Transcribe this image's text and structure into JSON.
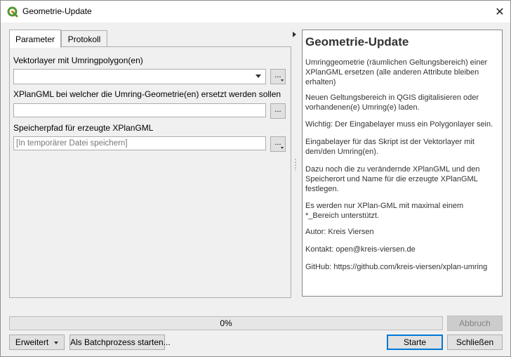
{
  "window": {
    "title": "Geometrie-Update",
    "close_symbol": "✕"
  },
  "tabs": [
    {
      "label": "Parameter",
      "active": true
    },
    {
      "label": "Protokoll",
      "active": false
    }
  ],
  "params": {
    "layer_label": "Vektorlayer mit Umringpolygon(en)",
    "layer_value": "",
    "xplan_label": "XPlanGML bei welcher die Umring-Geometrie(en) ersetzt werden sollen",
    "xplan_value": "",
    "output_label": "Speicherpfad für erzeugte XPlanGML",
    "output_placeholder": "[In temporärer Datei speichern]",
    "browse_label": "..."
  },
  "help": {
    "title": "Geometrie-Update",
    "paragraphs": [
      "Umringgeometrie (räumlichen Geltungsbereich) einer XPlanGML ersetzen (alle anderen Attribute bleiben erhalten)",
      "Neuen Geltungsbereich in QGIS digitalisieren oder vorhandenen(e) Umring(e) laden.",
      "Wichtig: Der Eingabelayer muss ein Polygonlayer sein.",
      "Eingabelayer für das Skript ist der Vektorlayer mit dem/den Umring(en).",
      "Dazu noch die zu verändernde XPlanGML und den Speicherort und Name für die erzeugte XPlanGML festlegen.",
      "Es werden nur XPlan-GML mit maximal einem *_Bereich unterstützt.",
      "Autor: Kreis Viersen",
      "Kontakt: open@kreis-viersen.de",
      "GitHub: https://github.com/kreis-viersen/xplan-umring"
    ]
  },
  "progress": {
    "value": 0,
    "text": "0%"
  },
  "buttons": {
    "cancel": "Abbruch",
    "advanced": "Erweitert",
    "batch": "Als Batchprozess starten...",
    "run": "Starte",
    "close": "Schließen"
  },
  "colors": {
    "accent": "#0078d7",
    "qgis_green": "#589632",
    "qgis_yellow": "#ee7913"
  },
  "icons": {
    "app": "qgis-logo-icon",
    "close": "close-icon"
  }
}
